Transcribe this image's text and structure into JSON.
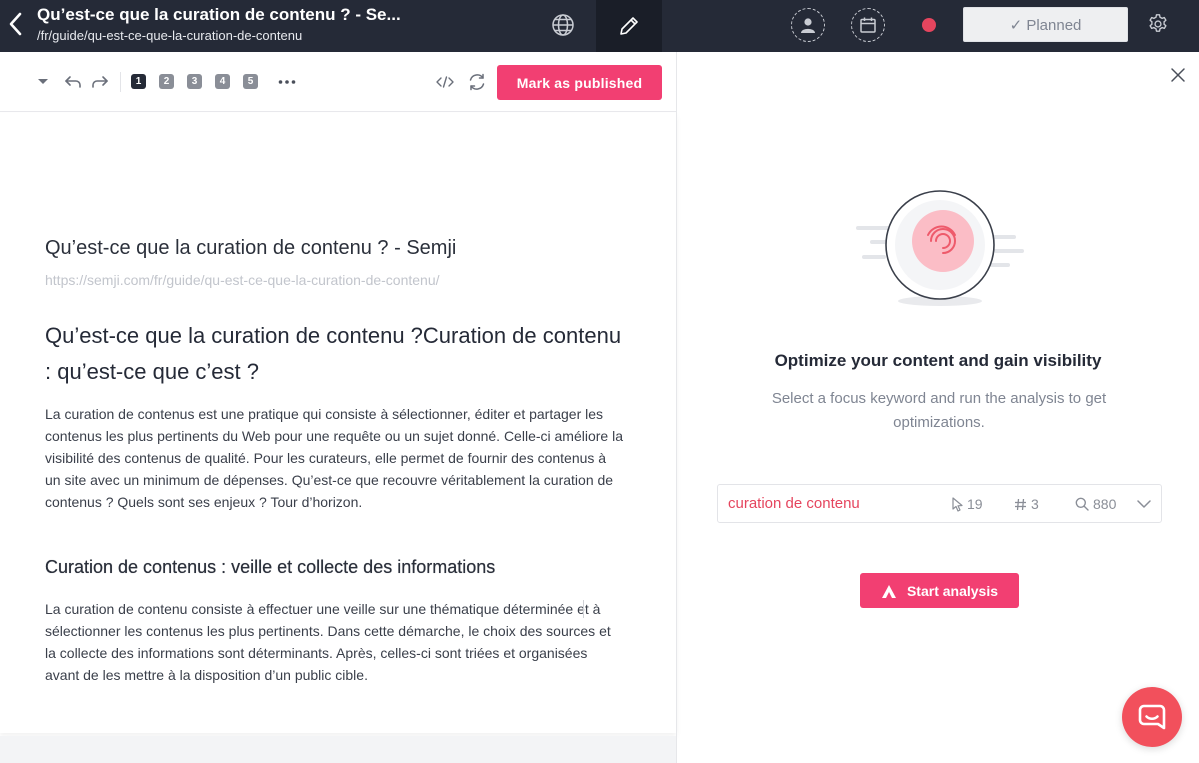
{
  "topbar": {
    "title": "Qu’est-ce que la curation de contenu ? - Se...",
    "url": "/fr/guide/qu-est-ce-que-la-curation-de-contenu",
    "status_label": "✓ Planned"
  },
  "toolbar": {
    "heading_levels": [
      "1",
      "2",
      "3",
      "4",
      "5"
    ],
    "publish_label": "Mark as published"
  },
  "document": {
    "seo_title": "Qu’est-ce que la curation de contenu ? - Semji",
    "seo_url": "https://semji.com/fr/guide/qu-est-ce-que-la-curation-de-contenu/",
    "h1": "Qu’est-ce que la curation de contenu ?Curation de contenu : qu’est-ce que c’est ?",
    "p1": "La curation de contenus est une pratique qui consiste à sélectionner, éditer et partager les contenus les plus pertinents du Web pour une requête ou un sujet donné. Celle-ci améliore la visibilité des contenus de qualité. Pour les curateurs, elle permet de fournir des contenus à un site avec un minimum de dépenses. Qu’est-ce que recouvre véritablement la curation de contenus ? Quels sont ses enjeux ? Tour d’horizon.",
    "h2": "Curation de contenus : veille et collecte des informations",
    "p2": "La curation de contenu consiste à effectuer une veille sur une thématique déterminée et à sélectionner les contenus les plus pertinents. Dans cette démarche, le choix des sources et la collecte des informations sont déterminants. Après, celles-ci sont triées et organisées avant de les mettre à la disposition d’un public cible."
  },
  "panel": {
    "heading": "Optimize your content and gain visibility",
    "subtext": "Select a focus keyword and run the analysis to get optimizations.",
    "keyword": {
      "text": "curation de contenu",
      "clicks": "19",
      "position": "3",
      "volume": "880"
    },
    "start_label": "Start analysis"
  },
  "colors": {
    "accent": "#f23f72",
    "topbar": "#252a37",
    "keyword": "#e5455e",
    "status_dot": "#e5455e",
    "chat": "#f2505c"
  },
  "icons": [
    "back-arrow-icon",
    "globe-icon",
    "pencil-icon",
    "user-icon",
    "calendar-icon",
    "gear-icon",
    "caret-down-icon",
    "undo-icon",
    "redo-icon",
    "more-icon",
    "code-icon",
    "refresh-icon",
    "close-icon",
    "cursor-icon",
    "hash-icon",
    "search-icon",
    "chevron-down-icon",
    "semji-logo-icon",
    "chat-icon"
  ]
}
